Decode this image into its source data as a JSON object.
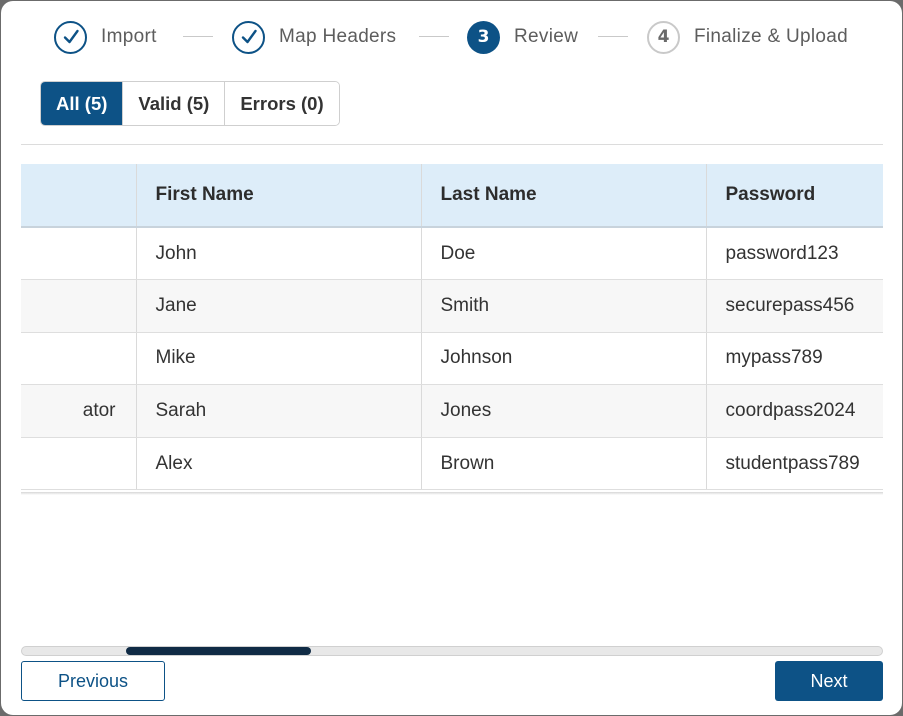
{
  "stepper": {
    "steps": [
      {
        "number": "",
        "label": "Import",
        "state": "done",
        "icon": "check-icon"
      },
      {
        "number": "",
        "label": "Map Headers",
        "state": "done",
        "icon": "check-icon"
      },
      {
        "number": "3",
        "label": "Review",
        "state": "current"
      },
      {
        "number": "4",
        "label": "Finalize & Upload",
        "state": "todo"
      }
    ]
  },
  "filters": [
    {
      "label": "All (5)",
      "active": true
    },
    {
      "label": "Valid (5)",
      "active": false
    },
    {
      "label": "Errors (0)",
      "active": false
    }
  ],
  "table": {
    "headers": [
      "",
      "First Name",
      "Last Name",
      "Password"
    ],
    "rows": [
      [
        "",
        "John",
        "Doe",
        "password123"
      ],
      [
        "",
        "Jane",
        "Smith",
        "securepass456"
      ],
      [
        "",
        "Mike",
        "Johnson",
        "mypass789"
      ],
      [
        "ator",
        "Sarah",
        "Jones",
        "coordpass2024"
      ],
      [
        "",
        "Alex",
        "Brown",
        "studentpass789"
      ]
    ]
  },
  "footer": {
    "previous_label": "Previous",
    "next_label": "Next"
  },
  "colors": {
    "primary": "#0d5286",
    "header_bg": "#ddedf9",
    "scroll_thumb": "#102b45"
  }
}
